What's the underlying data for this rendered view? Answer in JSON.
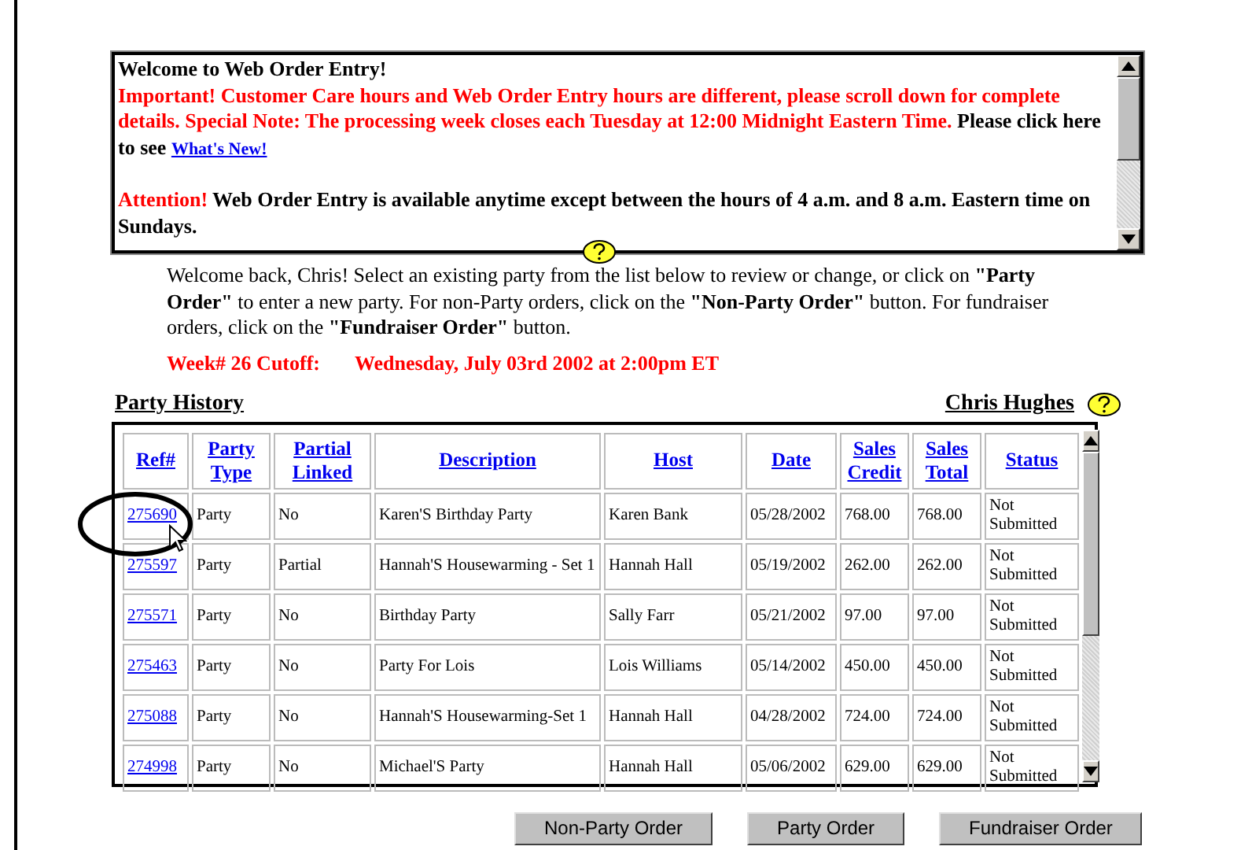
{
  "notice": {
    "title": "Welcome to Web Order Entry!",
    "important": "Important! Customer Care hours and Web Order Entry hours are different, please scroll down for complete details. Special Note: The processing week closes each Tuesday at 12:00 Midnight Eastern Time.",
    "prompt": "Please click here to see",
    "link": "What's New!",
    "attention_label": "Attention!",
    "attention": "Web Order Entry is available anytime except between the hours of 4 a.m. and 8 a.m. Eastern time on Sundays."
  },
  "intro": "Welcome back, Chris! Select an existing party from the list below to review or change, or click on **\"Party Order\"** to enter a new party. For non-Party orders, click on the **\"Non-Party Order\"** button. For fundraiser orders, click on the **\"Fundraiser Order\"** button.",
  "cutoff": {
    "label": "Week# 26 Cutoff:",
    "date": "Wednesday, July 03rd 2002 at 2:00pm ET"
  },
  "section_title": "Party History",
  "user_name": "Chris Hughes",
  "table": {
    "columns": [
      "Ref#",
      "Party Type",
      "Partial Linked",
      "Description",
      "Host",
      "Date",
      "Sales Credit",
      "Sales Total",
      "Status"
    ],
    "rows": [
      {
        "ref": "275690",
        "type": "Party",
        "linked": "No",
        "description": "Karen'S Birthday Party",
        "host": "Karen Bank",
        "date": "05/28/2002",
        "credit": "768.00",
        "total": "768.00",
        "status": "Not Submitted"
      },
      {
        "ref": "275597",
        "type": "Party",
        "linked": "Partial",
        "description": "Hannah'S Housewarming - Set 1",
        "host": "Hannah  Hall",
        "date": "05/19/2002",
        "credit": "262.00",
        "total": "262.00",
        "status": "Not Submitted"
      },
      {
        "ref": "275571",
        "type": "Party",
        "linked": "No",
        "description": "Birthday Party",
        "host": "Sally Farr",
        "date": "05/21/2002",
        "credit": "97.00",
        "total": "97.00",
        "status": "Not Submitted"
      },
      {
        "ref": "275463",
        "type": "Party",
        "linked": "No",
        "description": "Party For Lois",
        "host": "Lois Williams",
        "date": "05/14/2002",
        "credit": "450.00",
        "total": "450.00",
        "status": "Not Submitted"
      },
      {
        "ref": "275088",
        "type": "Party",
        "linked": "No",
        "description": "Hannah'S Housewarming-Set 1",
        "host": "Hannah Hall",
        "date": "04/28/2002",
        "credit": "724.00",
        "total": "724.00",
        "status": "Not Submitted"
      },
      {
        "ref": "274998",
        "type": "Party",
        "linked": "No",
        "description": "Michael'S Party",
        "host": "Hannah Hall",
        "date": "05/06/2002",
        "credit": "629.00",
        "total": "629.00",
        "status": "Not Submitted"
      }
    ]
  },
  "buttons": [
    "Non-Party Order",
    "Party Order",
    "Fundraiser Order"
  ]
}
